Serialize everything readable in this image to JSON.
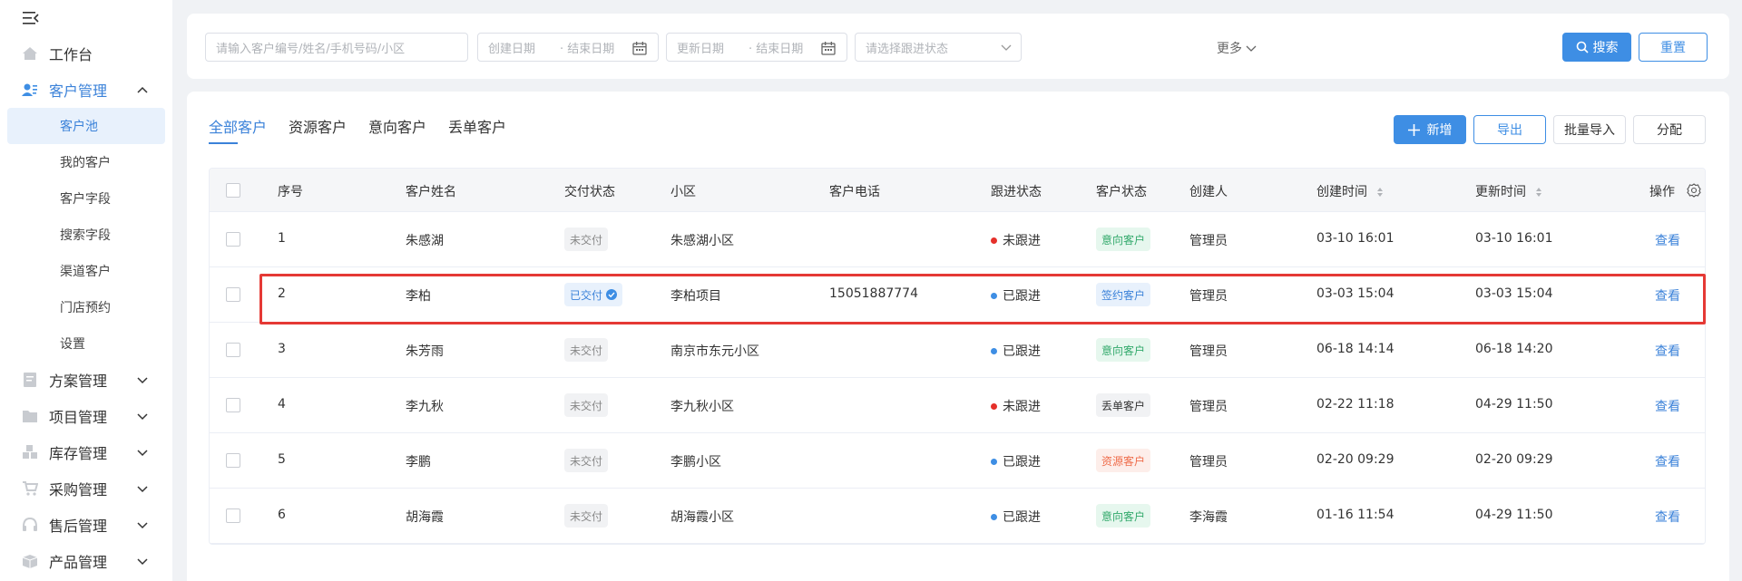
{
  "sidebar": {
    "items": [
      {
        "label": "工作台",
        "icon": "home-icon",
        "open": false
      },
      {
        "label": "客户管理",
        "icon": "customer-icon",
        "open": true
      },
      {
        "label": "方案管理",
        "icon": "document-icon",
        "open": false
      },
      {
        "label": "项目管理",
        "icon": "folder-icon",
        "open": false
      },
      {
        "label": "库存管理",
        "icon": "inventory-icon",
        "open": false
      },
      {
        "label": "采购管理",
        "icon": "cart-icon",
        "open": false
      },
      {
        "label": "售后管理",
        "icon": "headset-icon",
        "open": false
      },
      {
        "label": "产品管理",
        "icon": "box-icon",
        "open": false
      }
    ],
    "sub_items": [
      {
        "label": "客户池",
        "active": true
      },
      {
        "label": "我的客户",
        "active": false
      },
      {
        "label": "客户字段",
        "active": false
      },
      {
        "label": "搜索字段",
        "active": false
      },
      {
        "label": "渠道客户",
        "active": false
      },
      {
        "label": "门店预约",
        "active": false
      },
      {
        "label": "设置",
        "active": false
      }
    ]
  },
  "filters": {
    "keyword_placeholder": "请输入客户编号/姓名/手机号码/小区",
    "create_start": "创建日期",
    "create_end": "结束日期",
    "update_start": "更新日期",
    "update_end": "结束日期",
    "follow_placeholder": "请选择跟进状态",
    "more_label": "更多",
    "search_label": "搜索",
    "reset_label": "重置"
  },
  "tabs": [
    "全部客户",
    "资源客户",
    "意向客户",
    "丢单客户"
  ],
  "actions": {
    "add_label": "新增",
    "export_label": "导出",
    "batch_import_label": "批量导入",
    "assign_label": "分配"
  },
  "table": {
    "columns": [
      "序号",
      "客户姓名",
      "交付状态",
      "小区",
      "客户电话",
      "跟进状态",
      "客户状态",
      "创建人",
      "创建时间",
      "更新时间",
      "操作"
    ],
    "rows": [
      {
        "no": "1",
        "name": "朱感湖",
        "delivery": "未交付",
        "delivered": false,
        "community": "朱感湖小区",
        "phone": "",
        "follow": "未跟进",
        "follow_color": "#e5302a",
        "status": "意向客户",
        "status_style": "green",
        "creator": "管理员",
        "created": "03-10 16:01",
        "updated": "03-10 16:01",
        "action": "查看"
      },
      {
        "no": "2",
        "name": "李柏",
        "delivery": "已交付",
        "delivered": true,
        "community": "李柏项目",
        "phone": "15051887774",
        "follow": "已跟进",
        "follow_color": "#3e8ee4",
        "status": "签约客户",
        "status_style": "blue",
        "creator": "管理员",
        "created": "03-03 15:04",
        "updated": "03-03 15:04",
        "action": "查看"
      },
      {
        "no": "3",
        "name": "朱芳雨",
        "delivery": "未交付",
        "delivered": false,
        "community": "南京市东元小区",
        "phone": "",
        "follow": "已跟进",
        "follow_color": "#3e8ee4",
        "status": "意向客户",
        "status_style": "green",
        "creator": "管理员",
        "created": "06-18 14:14",
        "updated": "06-18 14:20",
        "action": "查看"
      },
      {
        "no": "4",
        "name": "李九秋",
        "delivery": "未交付",
        "delivered": false,
        "community": "李九秋小区",
        "phone": "",
        "follow": "未跟进",
        "follow_color": "#e5302a",
        "status": "丢单客户",
        "status_style": "dark",
        "creator": "管理员",
        "created": "02-22 11:18",
        "updated": "04-29 11:50",
        "action": "查看"
      },
      {
        "no": "5",
        "name": "李鹏",
        "delivery": "未交付",
        "delivered": false,
        "community": "李鹏小区",
        "phone": "",
        "follow": "已跟进",
        "follow_color": "#3e8ee4",
        "status": "资源客户",
        "status_style": "orange",
        "creator": "管理员",
        "created": "02-20 09:29",
        "updated": "02-20 09:29",
        "action": "查看"
      },
      {
        "no": "6",
        "name": "胡海霞",
        "delivery": "未交付",
        "delivered": false,
        "community": "胡海霞小区",
        "phone": "",
        "follow": "已跟进",
        "follow_color": "#3e8ee4",
        "status": "意向客户",
        "status_style": "green",
        "creator": "李海霞",
        "created": "01-16 11:54",
        "updated": "04-29 11:50",
        "action": "查看"
      }
    ]
  },
  "colors": {
    "accent": "#3e8ee4",
    "highlight": "#e53935"
  }
}
